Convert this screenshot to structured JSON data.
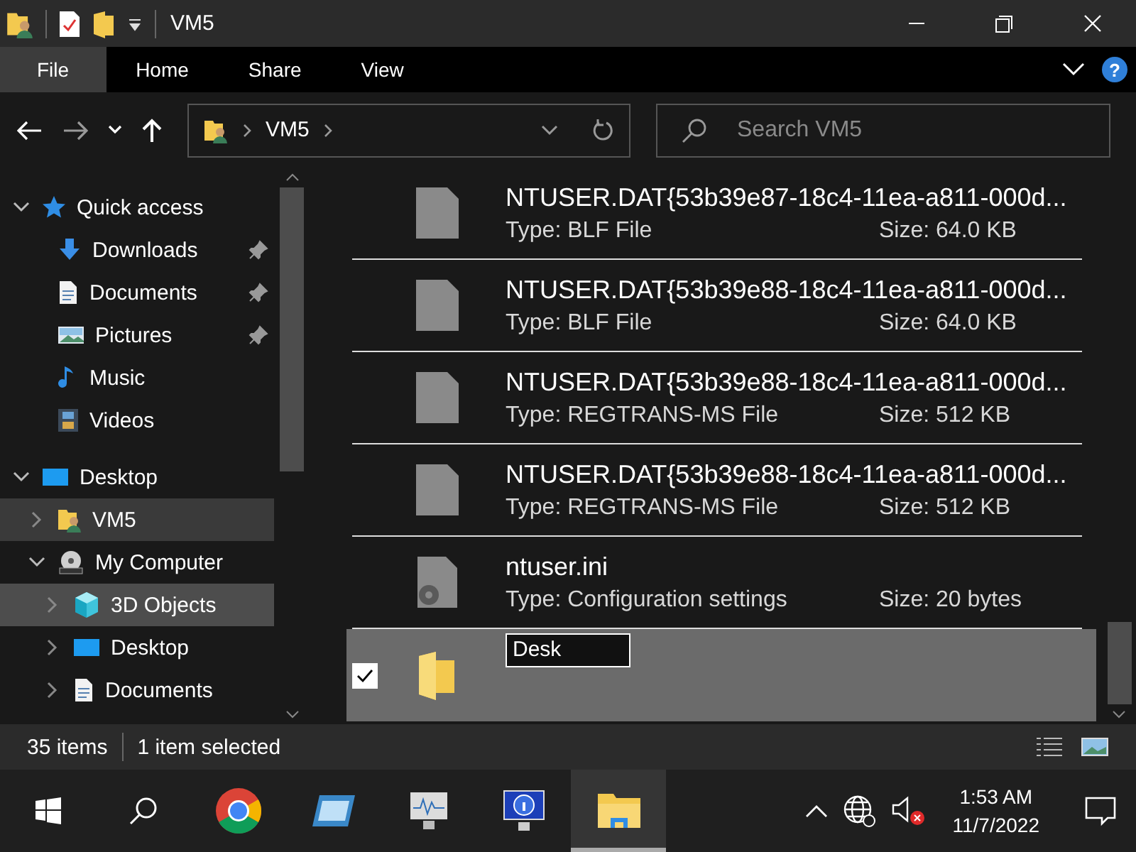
{
  "window": {
    "title": "VM5"
  },
  "ribbon": {
    "tabs": [
      {
        "label": "File",
        "selected": true
      },
      {
        "label": "Home",
        "selected": false
      },
      {
        "label": "Share",
        "selected": false
      },
      {
        "label": "View",
        "selected": false
      }
    ],
    "help": "?"
  },
  "address": {
    "segments": [
      "VM5"
    ]
  },
  "search": {
    "placeholder": "Search VM5"
  },
  "sidebar": {
    "items": [
      {
        "label": "Quick access",
        "kind": "star",
        "expandable": true,
        "expanded": true,
        "selected": false,
        "hovered": false,
        "children": [
          {
            "label": "Downloads",
            "kind": "download",
            "pinned": true,
            "expandable": false,
            "selected": false,
            "hovered": false
          },
          {
            "label": "Documents",
            "kind": "document",
            "pinned": true,
            "expandable": false,
            "selected": false,
            "hovered": false
          },
          {
            "label": "Pictures",
            "kind": "picture",
            "pinned": true,
            "expandable": false,
            "selected": false,
            "hovered": false
          },
          {
            "label": "Music",
            "kind": "music",
            "pinned": false,
            "expandable": false,
            "selected": false,
            "hovered": false
          },
          {
            "label": "Videos",
            "kind": "video",
            "pinned": false,
            "expandable": false,
            "selected": false,
            "hovered": false
          }
        ]
      },
      {
        "label": "Desktop",
        "kind": "desktop",
        "expandable": true,
        "expanded": true,
        "selected": false,
        "hovered": false,
        "children": [
          {
            "label": "VM5",
            "kind": "user",
            "expandable": true,
            "expanded": false,
            "selected": true,
            "hovered": false
          },
          {
            "label": "My Computer",
            "kind": "dvd",
            "expandable": true,
            "expanded": true,
            "selected": false,
            "hovered": false,
            "children": [
              {
                "label": "3D Objects",
                "kind": "cube",
                "expandable": true,
                "expanded": false,
                "selected": false,
                "hovered": true
              },
              {
                "label": "Desktop",
                "kind": "desktop",
                "expandable": true,
                "expanded": false,
                "selected": false,
                "hovered": false
              },
              {
                "label": "Documents",
                "kind": "document",
                "expandable": true,
                "expanded": false,
                "selected": false,
                "hovered": false
              }
            ]
          }
        ]
      }
    ]
  },
  "files": [
    {
      "kind": "file",
      "name": "NTUSER.DAT{53b39e87-18c4-11ea-a811-000d...",
      "type": "Type: BLF File",
      "size": "Size: 64.0 KB",
      "selected": false
    },
    {
      "kind": "file",
      "name": "NTUSER.DAT{53b39e88-18c4-11ea-a811-000d...",
      "type": "Type: BLF File",
      "size": "Size: 64.0 KB",
      "selected": false
    },
    {
      "kind": "file",
      "name": "NTUSER.DAT{53b39e88-18c4-11ea-a811-000d...",
      "type": "Type: REGTRANS-MS File",
      "size": "Size: 512 KB",
      "selected": false
    },
    {
      "kind": "file",
      "name": "NTUSER.DAT{53b39e88-18c4-11ea-a811-000d...",
      "type": "Type: REGTRANS-MS File",
      "size": "Size: 512 KB",
      "selected": false
    },
    {
      "kind": "settings",
      "name": "ntuser.ini",
      "type": "Type: Configuration settings",
      "size": "Size: 20 bytes",
      "selected": false
    },
    {
      "kind": "folder",
      "rename_value": "Desk",
      "selected": true
    }
  ],
  "status_bar": {
    "count": "35 items",
    "selection": "1 item selected"
  },
  "taskbar": {
    "apps": [
      {
        "kind": "start",
        "active": false
      },
      {
        "kind": "search",
        "active": false
      },
      {
        "kind": "chrome",
        "active": false
      },
      {
        "kind": "window",
        "active": false
      },
      {
        "kind": "monitor",
        "active": false
      },
      {
        "kind": "info",
        "active": false
      },
      {
        "kind": "explorer",
        "active": true
      }
    ],
    "time": "1:53 AM",
    "date": "11/7/2022"
  }
}
